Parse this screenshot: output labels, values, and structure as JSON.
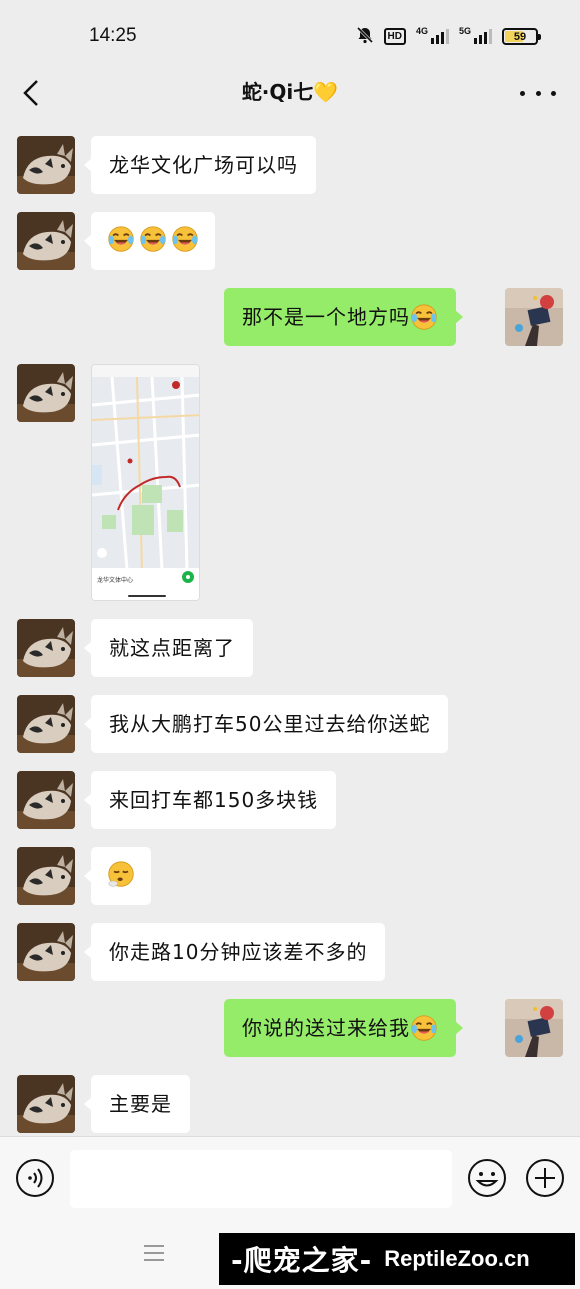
{
  "status_bar": {
    "time": "14:25",
    "hd_label": "HD",
    "net1_label": "4G",
    "net2_label": "5G",
    "battery_level": "59"
  },
  "nav": {
    "title": "蛇·Qi七",
    "title_heart": "💛"
  },
  "messages": [
    {
      "side": "left",
      "text": "龙华文化广场可以吗"
    },
    {
      "side": "left",
      "emoji": [
        "laugh-cry-emoji",
        "laugh-cry-emoji",
        "laugh-cry-emoji"
      ]
    },
    {
      "side": "right",
      "text": "那不是一个地方吗",
      "emoji": [
        "laugh-cry-emoji"
      ]
    },
    {
      "side": "left",
      "image": "map-screenshot",
      "map_place": "龙华文体中心"
    },
    {
      "side": "left",
      "text": "就这点距离了"
    },
    {
      "side": "left",
      "text": "我从大鹏打车50公里过去给你送蛇"
    },
    {
      "side": "left",
      "text": "来回打车都150多块钱"
    },
    {
      "side": "left",
      "emoji": [
        "sigh-emoji"
      ]
    },
    {
      "side": "left",
      "text": "你走路10分钟应该差不多的"
    },
    {
      "side": "right",
      "text": "你说的送过来给我",
      "emoji": [
        "laugh-cry-emoji"
      ]
    },
    {
      "side": "left",
      "text": "主要是"
    }
  ],
  "input": {
    "value": "",
    "placeholder": ""
  },
  "watermark": {
    "cn": "-爬宠之家-",
    "en": "ReptileZoo.cn"
  },
  "colors": {
    "background": "#ededed",
    "bubble_left": "#ffffff",
    "bubble_right": "#95ec69",
    "emoji_yellow": "#f7c23a"
  }
}
